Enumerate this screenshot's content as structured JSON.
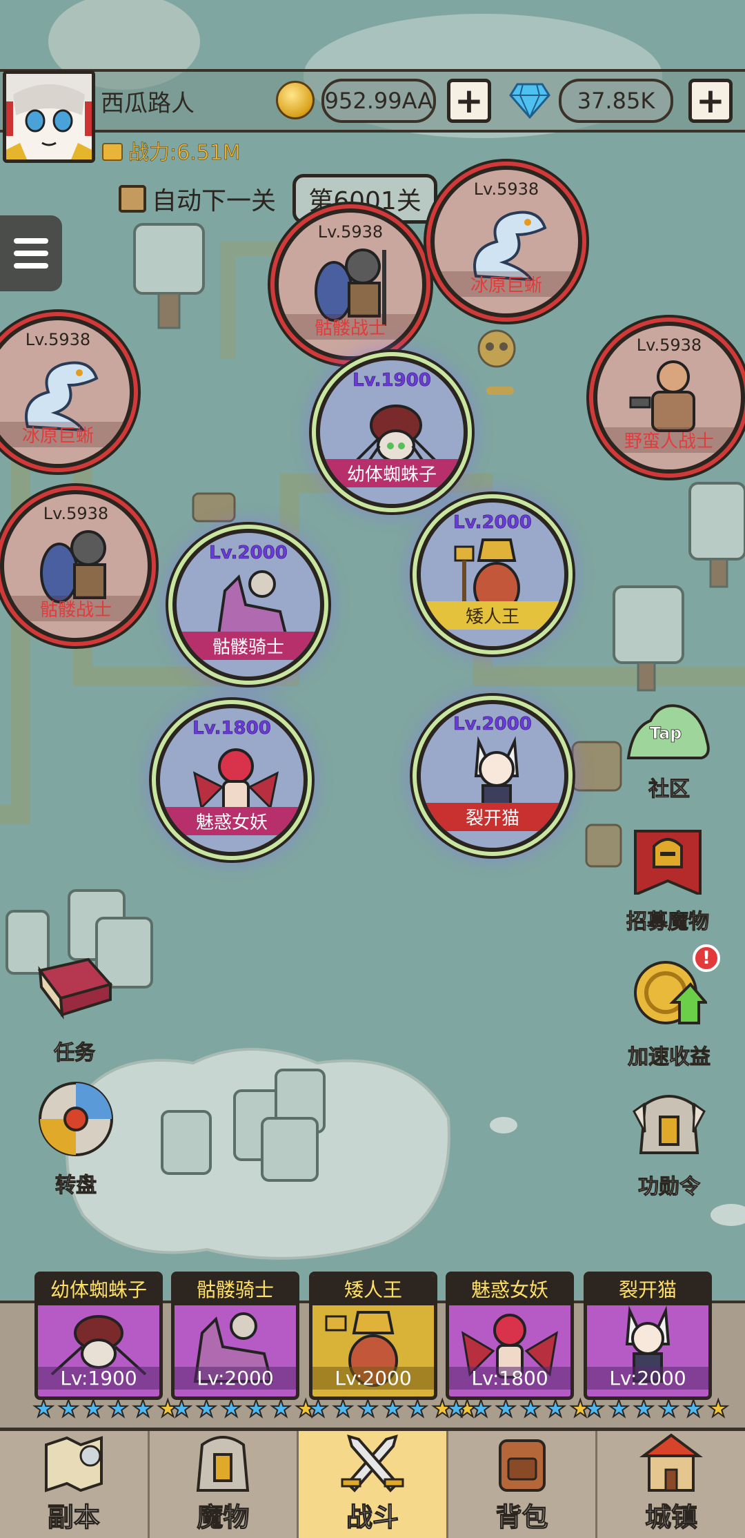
{
  "player": {
    "name": "西瓜路人",
    "power": "战力:6.51M"
  },
  "currency": {
    "gold": "952.99AA",
    "gems": "37.85K",
    "plus": "+"
  },
  "stage": {
    "auto_next": "自动下一关",
    "current": "第6001关"
  },
  "enemies": [
    {
      "level": "Lv.5938",
      "name": "骷髅战士"
    },
    {
      "level": "Lv.5938",
      "name": "冰原巨蜥"
    },
    {
      "level": "Lv.5938",
      "name": "冰原巨蜥"
    },
    {
      "level": "Lv.5938",
      "name": "野蛮人战士"
    },
    {
      "level": "Lv.5938",
      "name": "骷髅战士"
    }
  ],
  "allies": [
    {
      "level": "Lv.1900",
      "name": "幼体蜘蛛子"
    },
    {
      "level": "Lv.2000",
      "name": "矮人王"
    },
    {
      "level": "Lv.2000",
      "name": "骷髅骑士"
    },
    {
      "level": "Lv.1800",
      "name": "魅惑女妖"
    },
    {
      "level": "Lv.2000",
      "name": "裂开猫"
    }
  ],
  "side_buttons": {
    "community": "社区",
    "tap": "Tap",
    "recruit": "招募魔物",
    "speedup": "加速收益",
    "merit": "功勋令",
    "quest": "任务",
    "wheel": "转盘",
    "badge": "!"
  },
  "team": [
    {
      "name": "幼体蜘蛛子",
      "level": "Lv:1900",
      "stars": 5,
      "gold_stars": 1
    },
    {
      "name": "骷髅骑士",
      "level": "Lv:2000",
      "stars": 5,
      "gold_stars": 1
    },
    {
      "name": "矮人王",
      "level": "Lv:2000",
      "stars": 5,
      "gold_stars": 2
    },
    {
      "name": "魅惑女妖",
      "level": "Lv:1800",
      "stars": 5,
      "gold_stars": 1
    },
    {
      "name": "裂开猫",
      "level": "Lv:2000",
      "stars": 5,
      "gold_stars": 1
    }
  ],
  "nav": [
    {
      "label": "副本",
      "icon": "map-icon"
    },
    {
      "label": "魔物",
      "icon": "monster-icon"
    },
    {
      "label": "战斗",
      "icon": "swords-icon"
    },
    {
      "label": "背包",
      "icon": "backpack-icon"
    },
    {
      "label": "城镇",
      "icon": "town-icon"
    }
  ],
  "colors": {
    "enemy_ring": "#d23a3a",
    "ally_ring": "#c8e6a0",
    "active_tab": "#f6d88b",
    "map": "#7fa6a0"
  }
}
